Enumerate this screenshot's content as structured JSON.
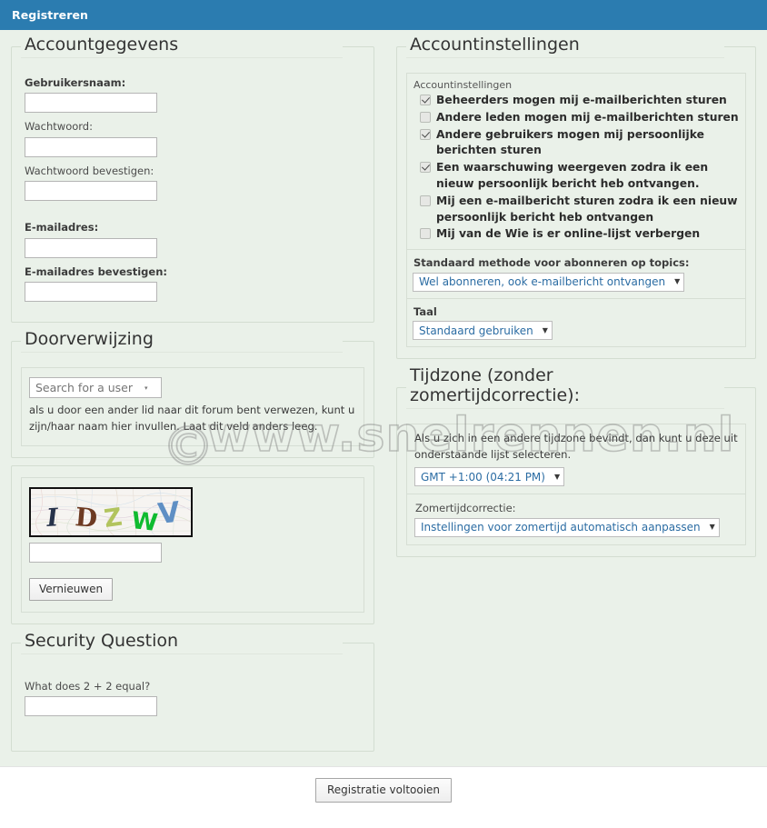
{
  "window": {
    "title": "Registreren"
  },
  "watermark": {
    "symbol": "©",
    "text": "www.snelrennen.nl"
  },
  "sections": {
    "account_details": {
      "legend": "Accountgegevens"
    },
    "account_settings": {
      "legend": "Accountinstellingen"
    },
    "referral": {
      "legend": "Doorverwijzing"
    },
    "timezone": {
      "legend": "Tijdzone (zonder zomertijdcorrectie):"
    },
    "security_question": {
      "legend": "Security Question"
    }
  },
  "account_details": {
    "fields": [
      {
        "label": "Gebruikersnaam:",
        "value": "",
        "bold": true
      },
      {
        "label": "Wachtwoord:",
        "value": "",
        "bold": false
      },
      {
        "label": "Wachtwoord bevestigen:",
        "value": "",
        "bold": false
      },
      {
        "label": "E-mailadres:",
        "value": "",
        "bold": true
      },
      {
        "label": "E-mailadres bevestigen:",
        "value": "",
        "bold": true
      }
    ]
  },
  "account_settings": {
    "panel_caption": "Accountinstellingen",
    "checkboxes": [
      {
        "label": "Beheerders mogen mij e-mailberichten sturen",
        "checked": true
      },
      {
        "label": "Andere leden mogen mij e-mailberichten sturen",
        "checked": false
      },
      {
        "label": "Andere gebruikers mogen mij persoonlijke berichten sturen",
        "checked": true
      },
      {
        "label": "Een waarschuwing weergeven zodra ik een nieuw persoonlijk bericht heb ontvangen.",
        "checked": true
      },
      {
        "label": "Mij een e-mailbericht sturen zodra ik een nieuw persoonlijk bericht heb ontvangen",
        "checked": false
      },
      {
        "label": "Mij van de Wie is er online-lijst verbergen",
        "checked": false
      }
    ],
    "subscription": {
      "label": "Standaard methode voor abonneren op topics:",
      "selected": "Wel abonneren, ook e-mailbericht ontvangen"
    },
    "language": {
      "label": "Taal",
      "selected": "Standaard gebruiken"
    }
  },
  "referral": {
    "search_placeholder": "Search for a user",
    "search_value": "",
    "hint": "als u door een ander lid naar dit forum bent verwezen, kunt u zijn/haar naam hier invullen. Laat dit veld anders leeg."
  },
  "captcha": {
    "letters": [
      {
        "char": "I",
        "color": "#26324a"
      },
      {
        "char": "D",
        "color": "#6d3a22"
      },
      {
        "char": "Z",
        "color": "#b2c45e"
      },
      {
        "char": "W",
        "color": "#0fbb30"
      },
      {
        "char": "V",
        "color": "#5e8fc4"
      }
    ],
    "input_value": "",
    "refresh_label": "Vernieuwen"
  },
  "timezone": {
    "description": "Als u zich in een andere tijdzone bevindt, dan kunt u deze uit onderstaande lijst selecteren.",
    "selected": "GMT +1:00 (04:21 PM)",
    "dst_label": "Zomertijdcorrectie:",
    "dst_selected": "Instellingen voor zomertijd automatisch aanpassen"
  },
  "security_question": {
    "question": "What does 2 + 2 equal?",
    "answer_value": ""
  },
  "footer": {
    "submit_label": "Registratie voltooien"
  },
  "colors": {
    "titlebar": "#2b7cb0",
    "body_bg": "#eaf1e9",
    "select_text": "#2b6ca3"
  },
  "icons": {
    "dropdown_arrow": "▼",
    "caret_small": "▾"
  }
}
